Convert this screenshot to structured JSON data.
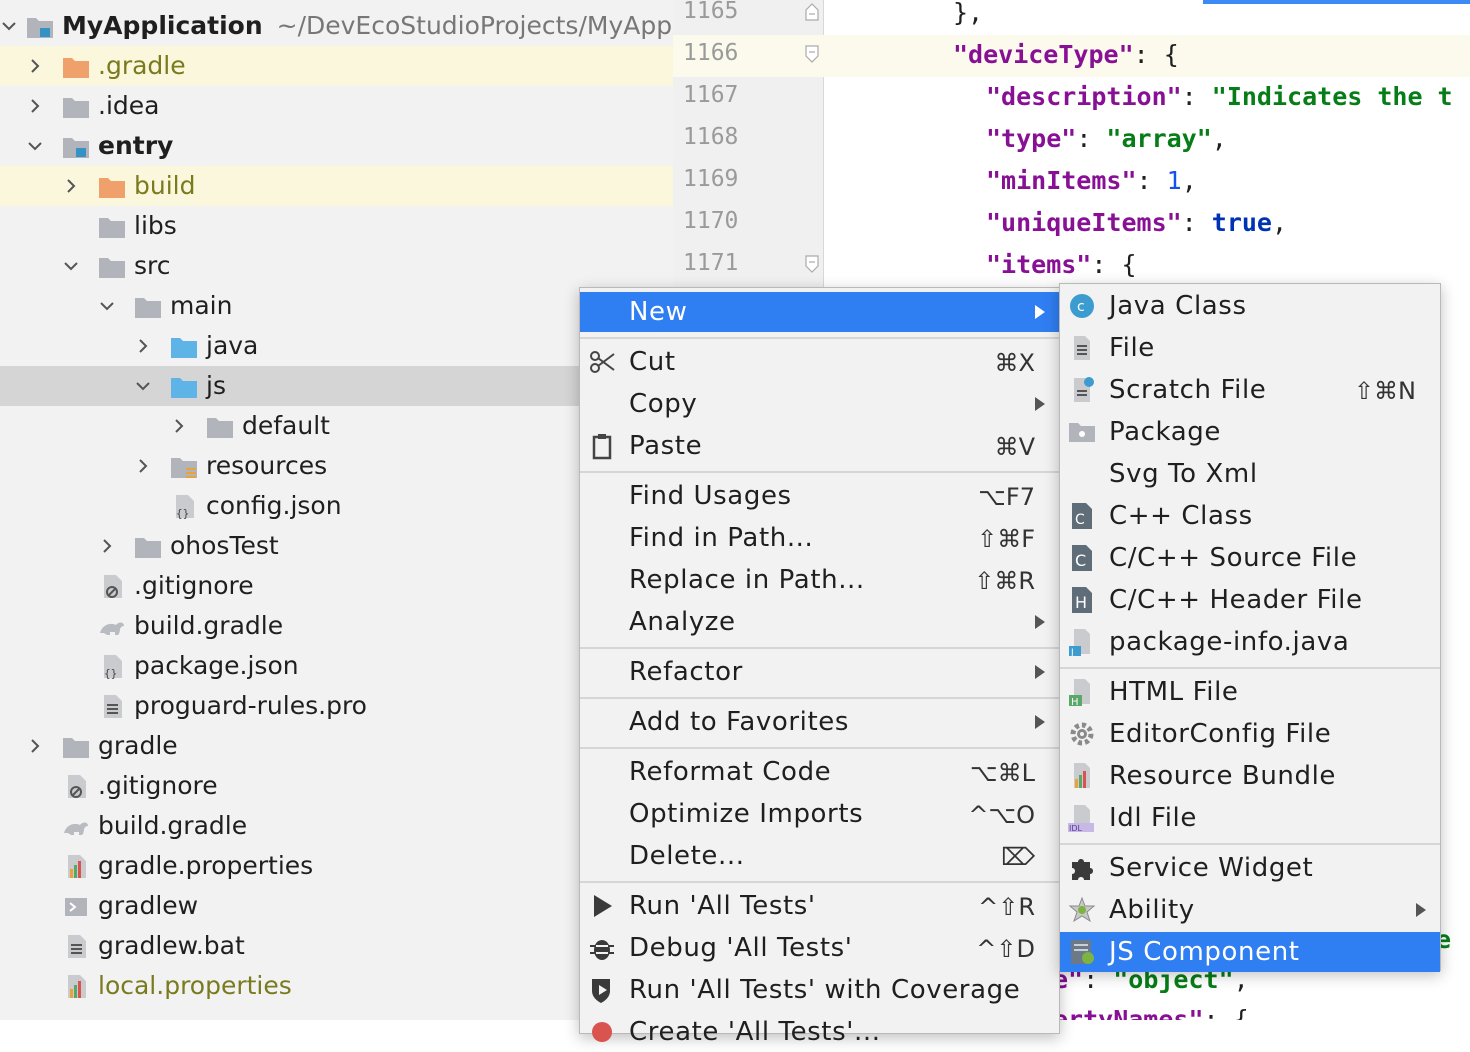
{
  "tree": {
    "root_name": "MyApplication",
    "root_path": "~/DevEcoStudioProjects/MyApp",
    "items": [
      {
        "label": ".gradle",
        "kind": "folder-orange",
        "style": "olive",
        "row": "hl",
        "indent": 1,
        "chev": "right"
      },
      {
        "label": ".idea",
        "kind": "folder",
        "style": "",
        "row": "",
        "indent": 1,
        "chev": "right"
      },
      {
        "label": "entry",
        "kind": "folder-module",
        "style": "bold",
        "row": "",
        "indent": 1,
        "chev": "down"
      },
      {
        "label": "build",
        "kind": "folder-orange",
        "style": "olive",
        "row": "hl",
        "indent": 2,
        "chev": "right"
      },
      {
        "label": "libs",
        "kind": "folder",
        "style": "",
        "row": "",
        "indent": 2,
        "chev": ""
      },
      {
        "label": "src",
        "kind": "folder",
        "style": "",
        "row": "",
        "indent": 2,
        "chev": "down"
      },
      {
        "label": "main",
        "kind": "folder",
        "style": "",
        "row": "",
        "indent": 3,
        "chev": "down"
      },
      {
        "label": "java",
        "kind": "folder-blue",
        "style": "",
        "row": "",
        "indent": 4,
        "chev": "right"
      },
      {
        "label": "js",
        "kind": "folder-blue",
        "style": "",
        "row": "sel",
        "indent": 4,
        "chev": "down"
      },
      {
        "label": "default",
        "kind": "folder",
        "style": "",
        "row": "",
        "indent": 5,
        "chev": "right"
      },
      {
        "label": "resources",
        "kind": "folder-res",
        "style": "",
        "row": "",
        "indent": 4,
        "chev": "right"
      },
      {
        "label": "config.json",
        "kind": "file-json",
        "style": "",
        "row": "",
        "indent": 4,
        "chev": ""
      },
      {
        "label": "ohosTest",
        "kind": "folder",
        "style": "",
        "row": "",
        "indent": 3,
        "chev": "right"
      },
      {
        "label": ".gitignore",
        "kind": "file-ignore",
        "style": "",
        "row": "",
        "indent": 2,
        "chev": ""
      },
      {
        "label": "build.gradle",
        "kind": "file-gradle",
        "style": "",
        "row": "",
        "indent": 2,
        "chev": ""
      },
      {
        "label": "package.json",
        "kind": "file-json",
        "style": "",
        "row": "",
        "indent": 2,
        "chev": ""
      },
      {
        "label": "proguard-rules.pro",
        "kind": "file-text",
        "style": "",
        "row": "",
        "indent": 2,
        "chev": ""
      },
      {
        "label": "gradle",
        "kind": "folder",
        "style": "",
        "row": "",
        "indent": 1,
        "chev": "right"
      },
      {
        "label": ".gitignore",
        "kind": "file-ignore",
        "style": "",
        "row": "",
        "indent": 1,
        "chev": ""
      },
      {
        "label": "build.gradle",
        "kind": "file-gradle",
        "style": "",
        "row": "",
        "indent": 1,
        "chev": ""
      },
      {
        "label": "gradle.properties",
        "kind": "file-props",
        "style": "",
        "row": "",
        "indent": 1,
        "chev": ""
      },
      {
        "label": "gradlew",
        "kind": "file-exec",
        "style": "",
        "row": "",
        "indent": 1,
        "chev": ""
      },
      {
        "label": "gradlew.bat",
        "kind": "file-text",
        "style": "",
        "row": "",
        "indent": 1,
        "chev": ""
      },
      {
        "label": "local.properties",
        "kind": "file-props",
        "style": "olive",
        "row": "",
        "indent": 1,
        "chev": ""
      }
    ]
  },
  "editor": {
    "lines": [
      {
        "num": "1165",
        "code": [
          [
            "p",
            "},"
          ]
        ],
        "indent": 0,
        "fold": "end"
      },
      {
        "num": "1166",
        "code": [
          [
            "k",
            "\"deviceType\""
          ],
          [
            "p",
            ": {"
          ]
        ],
        "indent": 0,
        "fold": "start",
        "current": true
      },
      {
        "num": "1167",
        "code": [
          [
            "k",
            "\"description\""
          ],
          [
            "p",
            ": "
          ],
          [
            "s",
            "\"Indicates the t"
          ]
        ],
        "indent": 1,
        "fold": ""
      },
      {
        "num": "1168",
        "code": [
          [
            "k",
            "\"type\""
          ],
          [
            "p",
            ": "
          ],
          [
            "s",
            "\"array\""
          ],
          [
            "p",
            ","
          ]
        ],
        "indent": 1,
        "fold": ""
      },
      {
        "num": "1169",
        "code": [
          [
            "k",
            "\"minItems\""
          ],
          [
            "p",
            ": "
          ],
          [
            "n",
            "1"
          ],
          [
            "p",
            ","
          ]
        ],
        "indent": 1,
        "fold": ""
      },
      {
        "num": "1170",
        "code": [
          [
            "k",
            "\"uniqueItems\""
          ],
          [
            "p",
            ": "
          ],
          [
            "b",
            "true"
          ],
          [
            "p",
            ","
          ]
        ],
        "indent": 1,
        "fold": ""
      },
      {
        "num": "1171",
        "code": [
          [
            "k",
            "\"items\""
          ],
          [
            "p",
            ": {"
          ]
        ],
        "indent": 1,
        "fold": "start"
      }
    ],
    "peek_fragments": {
      "right_edge": "e (",
      "object_line_key": "e\"",
      "object_line_rest": ": ",
      "object_value": "\"object\"",
      "object_comma": ",",
      "bottom_key": "ertyNames\"",
      "bottom_rest": ": {"
    }
  },
  "context_menu": {
    "items": [
      {
        "type": "item",
        "label": "New",
        "shortcut": "",
        "submenu": true,
        "active": true,
        "icon": ""
      },
      {
        "type": "sep"
      },
      {
        "type": "item",
        "label": "Cut",
        "shortcut": "⌘X",
        "submenu": false,
        "icon": "scissors-icon"
      },
      {
        "type": "item",
        "label": "Copy",
        "shortcut": "",
        "submenu": true,
        "icon": ""
      },
      {
        "type": "item",
        "label": "Paste",
        "shortcut": "⌘V",
        "submenu": false,
        "icon": "clipboard-icon"
      },
      {
        "type": "sep"
      },
      {
        "type": "item",
        "label": "Find Usages",
        "shortcut": "⌥F7",
        "submenu": false,
        "icon": ""
      },
      {
        "type": "item",
        "label": "Find in Path...",
        "shortcut": "⇧⌘F",
        "submenu": false,
        "icon": ""
      },
      {
        "type": "item",
        "label": "Replace in Path...",
        "shortcut": "⇧⌘R",
        "submenu": false,
        "icon": ""
      },
      {
        "type": "item",
        "label": "Analyze",
        "shortcut": "",
        "submenu": true,
        "icon": ""
      },
      {
        "type": "sep"
      },
      {
        "type": "item",
        "label": "Refactor",
        "shortcut": "",
        "submenu": true,
        "icon": ""
      },
      {
        "type": "sep"
      },
      {
        "type": "item",
        "label": "Add to Favorites",
        "shortcut": "",
        "submenu": true,
        "icon": ""
      },
      {
        "type": "sep"
      },
      {
        "type": "item",
        "label": "Reformat Code",
        "shortcut": "⌥⌘L",
        "submenu": false,
        "icon": ""
      },
      {
        "type": "item",
        "label": "Optimize Imports",
        "shortcut": "^⌥O",
        "submenu": false,
        "icon": ""
      },
      {
        "type": "item",
        "label": "Delete...",
        "shortcut": "⌦",
        "submenu": false,
        "icon": ""
      },
      {
        "type": "sep"
      },
      {
        "type": "item",
        "label": "Run 'All Tests'",
        "shortcut": "^⇧R",
        "submenu": false,
        "icon": "run-icon"
      },
      {
        "type": "item",
        "label": "Debug 'All Tests'",
        "shortcut": "^⇧D",
        "submenu": false,
        "icon": "bug-icon"
      },
      {
        "type": "item",
        "label": "Run 'All Tests' with Coverage",
        "shortcut": "",
        "submenu": false,
        "icon": "coverage-icon"
      },
      {
        "type": "item",
        "label": "Create 'All Tests'...",
        "shortcut": "",
        "submenu": false,
        "icon": "create-test-icon"
      }
    ]
  },
  "new_submenu": {
    "items": [
      {
        "type": "item",
        "label": "Java Class",
        "shortcut": "",
        "submenu": false,
        "icon": "java-class-icon"
      },
      {
        "type": "item",
        "label": "File",
        "shortcut": "",
        "submenu": false,
        "icon": "file-icon"
      },
      {
        "type": "item",
        "label": "Scratch File",
        "shortcut": "⇧⌘N",
        "submenu": false,
        "icon": "scratch-file-icon"
      },
      {
        "type": "item",
        "label": "Package",
        "shortcut": "",
        "submenu": false,
        "icon": "package-icon"
      },
      {
        "type": "item",
        "label": "Svg To Xml",
        "shortcut": "",
        "submenu": false,
        "icon": ""
      },
      {
        "type": "item",
        "label": "C++ Class",
        "shortcut": "",
        "submenu": false,
        "icon": "cpp-class-icon"
      },
      {
        "type": "item",
        "label": "C/C++ Source File",
        "shortcut": "",
        "submenu": false,
        "icon": "c-source-icon"
      },
      {
        "type": "item",
        "label": "C/C++ Header File",
        "shortcut": "",
        "submenu": false,
        "icon": "c-header-icon"
      },
      {
        "type": "item",
        "label": "package-info.java",
        "shortcut": "",
        "submenu": false,
        "icon": "package-info-icon"
      },
      {
        "type": "sep"
      },
      {
        "type": "item",
        "label": "HTML File",
        "shortcut": "",
        "submenu": false,
        "icon": "html-file-icon"
      },
      {
        "type": "item",
        "label": "EditorConfig File",
        "shortcut": "",
        "submenu": false,
        "icon": "gear-icon"
      },
      {
        "type": "item",
        "label": "Resource Bundle",
        "shortcut": "",
        "submenu": false,
        "icon": "resource-bundle-icon"
      },
      {
        "type": "item",
        "label": "Idl File",
        "shortcut": "",
        "submenu": false,
        "icon": "idl-file-icon"
      },
      {
        "type": "sep"
      },
      {
        "type": "item",
        "label": "Service Widget",
        "shortcut": "",
        "submenu": false,
        "icon": "puzzle-icon"
      },
      {
        "type": "item",
        "label": "Ability",
        "shortcut": "",
        "submenu": true,
        "icon": "ability-icon"
      },
      {
        "type": "item",
        "label": "JS Component",
        "shortcut": "",
        "submenu": false,
        "active": true,
        "icon": "js-component-icon"
      }
    ]
  },
  "colors": {
    "accent": "#2f7ef2",
    "tree_highlight": "#fbf7dc",
    "tree_selected": "#d5d5d5",
    "json_key": "#871094",
    "json_string": "#067d17"
  }
}
